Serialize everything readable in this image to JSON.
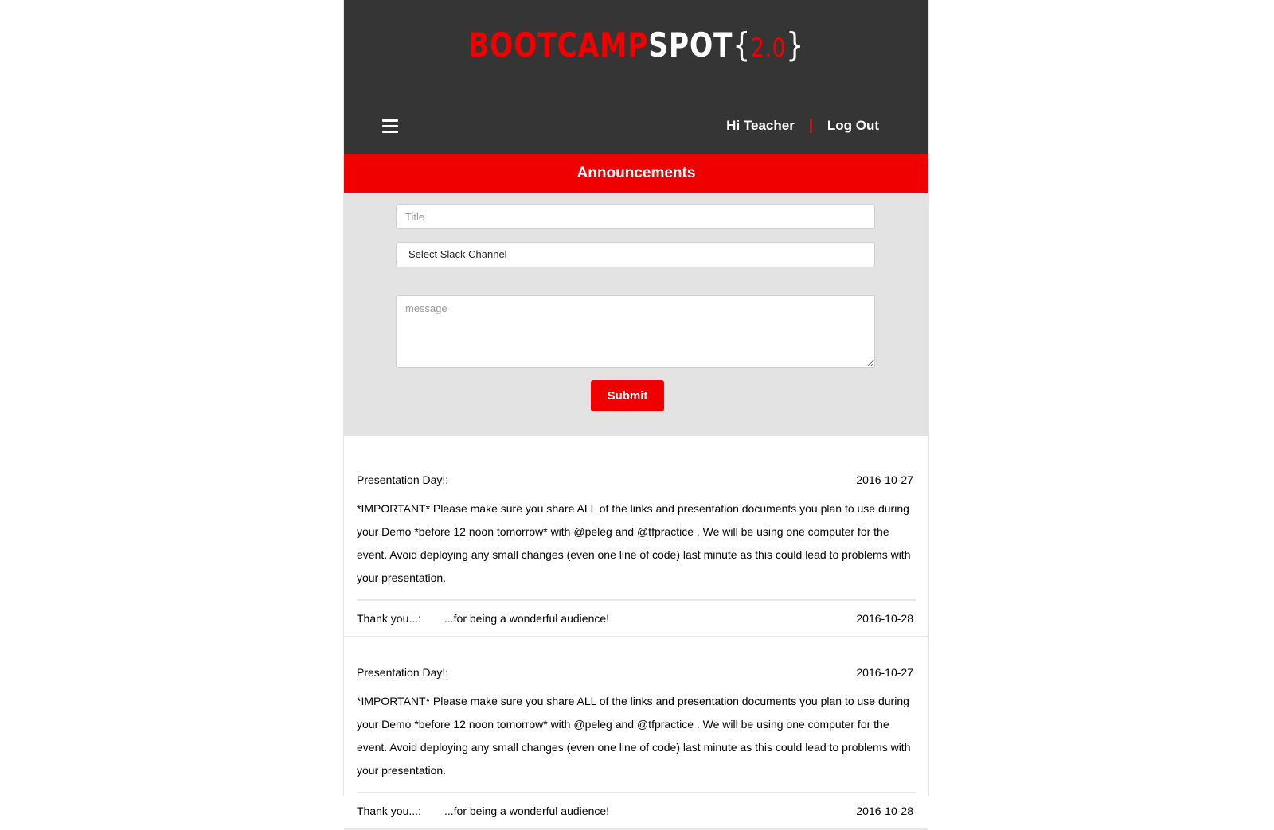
{
  "brand": {
    "part1": "BOOTCAMP",
    "part2": "SPOT",
    "brace_open": "{",
    "version": "2.0",
    "brace_close": "}"
  },
  "header": {
    "greeting": "Hi Teacher",
    "logout": "Log Out"
  },
  "section": {
    "title": "Announcements"
  },
  "form": {
    "title_placeholder": "Title",
    "channel_select": "Select Slack Channel",
    "message_placeholder": "message",
    "submit_label": "Submit"
  },
  "announcements": [
    {
      "title": "Presentation Day!:",
      "date": "2016-10-27",
      "body": "*IMPORTANT* Please make sure you share ALL of the links and presentation documents you plan to use during your Demo *before 12 noon tomorrow* with @peleg and @tfpractice . We will be using one computer for the event. Avoid deploying any small changes (even one line of code) last minute as this could lead to problems with your presentation."
    },
    {
      "title": "Thank you...:",
      "message": "...for being a wonderful audience!",
      "date": "2016-10-28"
    },
    {
      "title": "Presentation Day!:",
      "date": "2016-10-27",
      "body": "*IMPORTANT* Please make sure you share ALL of the links and presentation documents you plan to use during your Demo *before 12 noon tomorrow* with @peleg and @tfpractice . We will be using one computer for the event. Avoid deploying any small changes (even one line of code) last minute as this could lead to problems with your presentation."
    },
    {
      "title": "Thank you...:",
      "message": "...for being a wonderful audience!",
      "date": "2016-10-28"
    }
  ],
  "colors": {
    "header_bg": "#353535",
    "accent_red": "#f00000",
    "form_bg": "#e3e3e3"
  }
}
